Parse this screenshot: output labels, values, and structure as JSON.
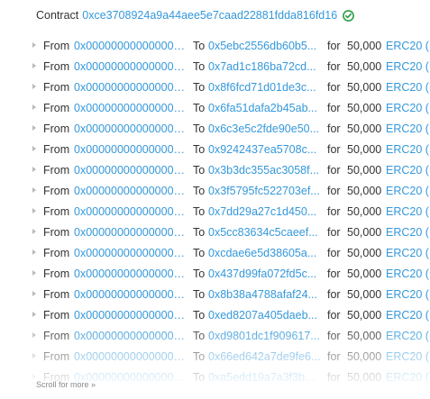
{
  "contract": {
    "label": "Contract",
    "address": "0xce3708924a9a44aee5e7caad22881fdda816fd16",
    "verified_icon": "check-circle-icon",
    "verified_color": "#2e9e44"
  },
  "transfers": [
    {
      "from_label": "From",
      "from": "0x0000000000000000...",
      "to_label": "To",
      "to": "0x5ebc2556db60b5...",
      "for_label": "for",
      "amount": "50,000",
      "token": "ERC20 ("
    },
    {
      "from_label": "From",
      "from": "0x0000000000000000...",
      "to_label": "To",
      "to": "0x7ad1c186ba72cd...",
      "for_label": "for",
      "amount": "50,000",
      "token": "ERC20 ("
    },
    {
      "from_label": "From",
      "from": "0x0000000000000000...",
      "to_label": "To",
      "to": "0x8f6fcd71d01de3c...",
      "for_label": "for",
      "amount": "50,000",
      "token": "ERC20 ("
    },
    {
      "from_label": "From",
      "from": "0x0000000000000000...",
      "to_label": "To",
      "to": "0x6fa51dafa2b45ab...",
      "for_label": "for",
      "amount": "50,000",
      "token": "ERC20 ("
    },
    {
      "from_label": "From",
      "from": "0x0000000000000000...",
      "to_label": "To",
      "to": "0x6c3e5c2fde90e50...",
      "for_label": "for",
      "amount": "50,000",
      "token": "ERC20 ("
    },
    {
      "from_label": "From",
      "from": "0x0000000000000000...",
      "to_label": "To",
      "to": "0x9242437ea5708c...",
      "for_label": "for",
      "amount": "50,000",
      "token": "ERC20 ("
    },
    {
      "from_label": "From",
      "from": "0x0000000000000000...",
      "to_label": "To",
      "to": "0x3b3dc355ac3058f...",
      "for_label": "for",
      "amount": "50,000",
      "token": "ERC20 ("
    },
    {
      "from_label": "From",
      "from": "0x0000000000000000...",
      "to_label": "To",
      "to": "0x3f5795fc522703ef...",
      "for_label": "for",
      "amount": "50,000",
      "token": "ERC20 ("
    },
    {
      "from_label": "From",
      "from": "0x0000000000000000...",
      "to_label": "To",
      "to": "0x7dd29a27c1d450...",
      "for_label": "for",
      "amount": "50,000",
      "token": "ERC20 ("
    },
    {
      "from_label": "From",
      "from": "0x0000000000000000...",
      "to_label": "To",
      "to": "0x5cc83634c5caeef...",
      "for_label": "for",
      "amount": "50,000",
      "token": "ERC20 ("
    },
    {
      "from_label": "From",
      "from": "0x0000000000000000...",
      "to_label": "To",
      "to": "0xcdae6e5d38605a...",
      "for_label": "for",
      "amount": "50,000",
      "token": "ERC20 ("
    },
    {
      "from_label": "From",
      "from": "0x0000000000000000...",
      "to_label": "To",
      "to": "0x437d99fa072fd5c...",
      "for_label": "for",
      "amount": "50,000",
      "token": "ERC20 ("
    },
    {
      "from_label": "From",
      "from": "0x0000000000000000...",
      "to_label": "To",
      "to": "0x8b38a4788afaf24...",
      "for_label": "for",
      "amount": "50,000",
      "token": "ERC20 ("
    },
    {
      "from_label": "From",
      "from": "0x0000000000000000...",
      "to_label": "To",
      "to": "0xed8207a405daeb...",
      "for_label": "for",
      "amount": "50,000",
      "token": "ERC20 ("
    },
    {
      "from_label": "From",
      "from": "0x0000000000000000...",
      "to_label": "To",
      "to": "0xd9801dc1f909617...",
      "for_label": "for",
      "amount": "50,000",
      "token": "ERC20 ("
    },
    {
      "from_label": "From",
      "from": "0x0000000000000000...",
      "to_label": "To",
      "to": "0x66ed642a7de9fe6...",
      "for_label": "for",
      "amount": "50,000",
      "token": "ERC20 ("
    },
    {
      "from_label": "From",
      "from": "0x0000000000000000...",
      "to_label": "To",
      "to": "0xa5edd19a7a3f3b7f9...",
      "for_label": "for",
      "amount": "50,000",
      "token": "ERC20 ("
    }
  ],
  "scroll_hint": {
    "label": "Scroll for more",
    "icon": "double-chevron-down-icon"
  }
}
